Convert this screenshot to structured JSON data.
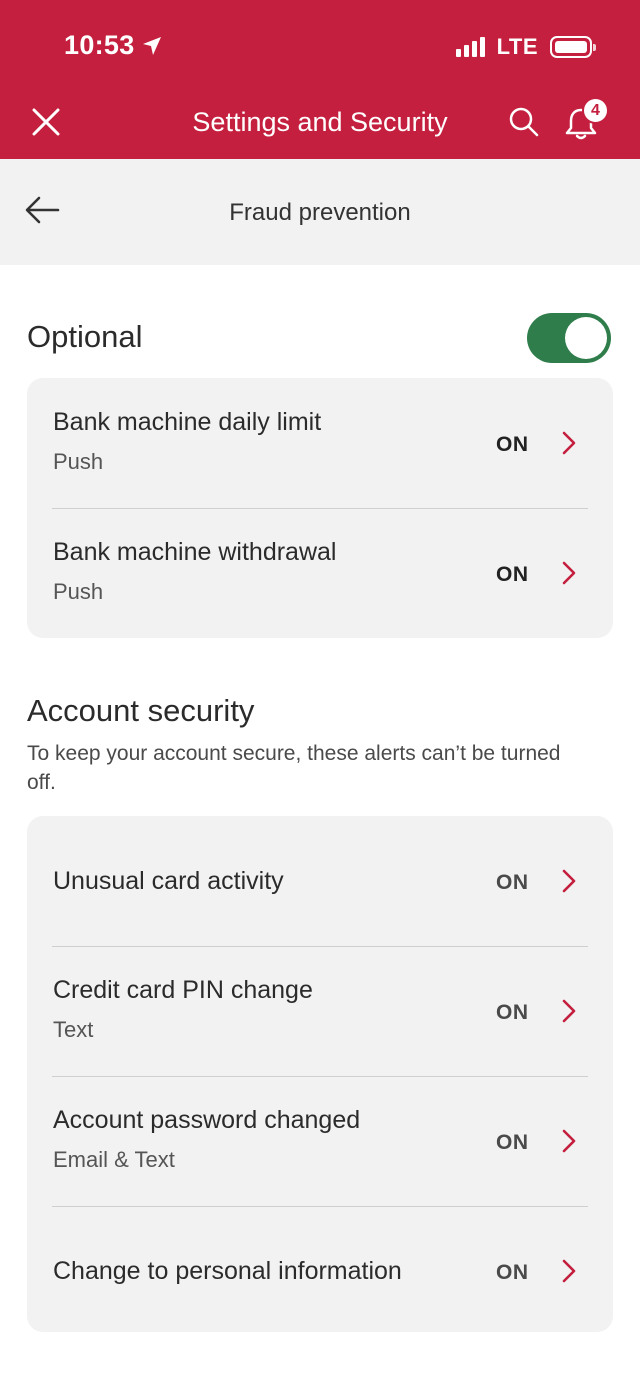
{
  "status_bar": {
    "time": "10:53",
    "network": "LTE"
  },
  "app_bar": {
    "title": "Settings and Security",
    "notification_count": "4"
  },
  "sub_header": {
    "title": "Fraud prevention"
  },
  "optional": {
    "title": "Optional",
    "toggle_on": true,
    "items": [
      {
        "label": "Bank machine daily limit",
        "sub": "Push",
        "state": "ON"
      },
      {
        "label": "Bank machine withdrawal",
        "sub": "Push",
        "state": "ON"
      }
    ]
  },
  "account_security": {
    "title": "Account security",
    "description": "To keep your account secure, these alerts can’t be turned off.",
    "items": [
      {
        "label": "Unusual card activity",
        "sub": "",
        "state": "ON"
      },
      {
        "label": "Credit card PIN change",
        "sub": "Text",
        "state": "ON"
      },
      {
        "label": "Account password changed",
        "sub": "Email & Text",
        "state": "ON"
      },
      {
        "label": "Change to personal information",
        "sub": "",
        "state": "ON"
      }
    ]
  },
  "colors": {
    "brand_red": "#c41f3e",
    "toggle_green": "#2f7d4b",
    "card_bg": "#f2f2f2"
  }
}
